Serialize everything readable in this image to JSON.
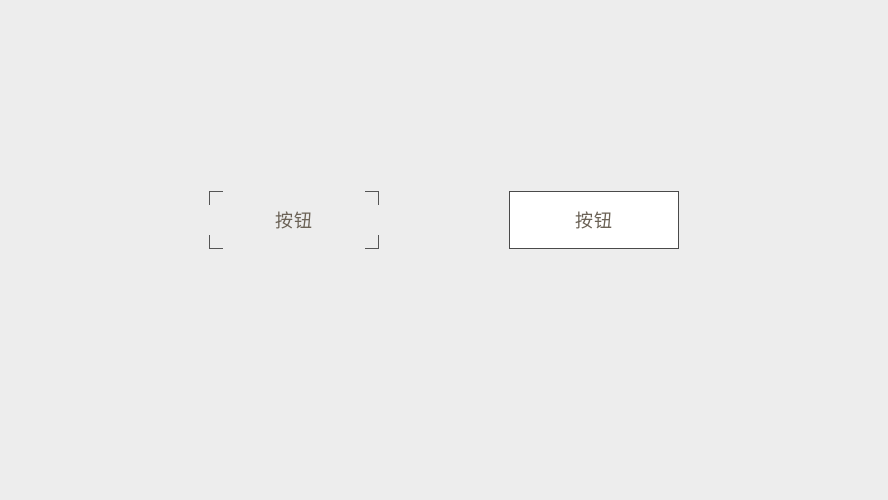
{
  "buttons": {
    "dashed": {
      "label": "按钮"
    },
    "solid": {
      "label": "按钮"
    }
  }
}
